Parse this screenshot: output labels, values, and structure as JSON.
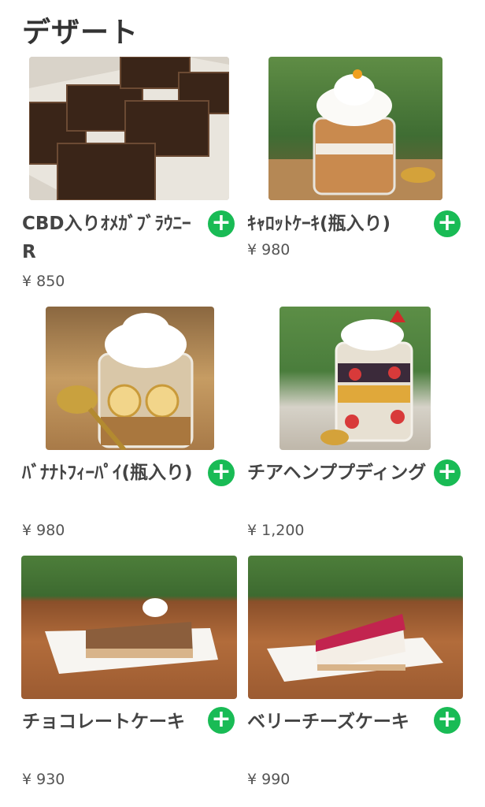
{
  "section": {
    "title": "デザート"
  },
  "items": [
    {
      "name": "CBD入りｵﾒｶﾞﾌﾞﾗｳﾆｰR",
      "price": "¥ 850"
    },
    {
      "name": "ｷｬﾛｯﾄｹｰｷ(瓶入り)",
      "price": "¥ 980"
    },
    {
      "name": "ﾊﾞﾅﾅﾄﾌｨｰﾊﾟｲ(瓶入り)",
      "price": "¥ 980"
    },
    {
      "name": "チアヘンププディング",
      "price": "¥ 1,200"
    },
    {
      "name": "チョコレートケーキ",
      "price": "¥ 930"
    },
    {
      "name": "ベリーチーズケーキ",
      "price": "¥ 990"
    }
  ],
  "add_button_icon": "plus-icon",
  "colors": {
    "accent": "#19bb55",
    "text": "#333333"
  }
}
